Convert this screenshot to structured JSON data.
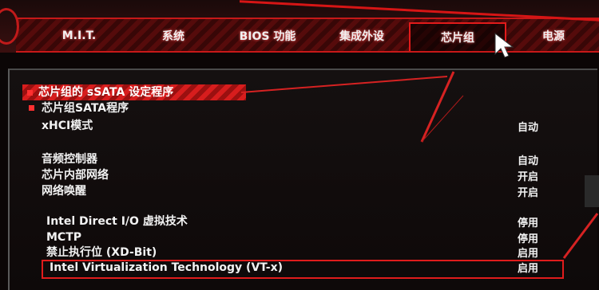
{
  "tabs": [
    {
      "label": "M.I.T."
    },
    {
      "label": "系统"
    },
    {
      "label": "BIOS 功能"
    },
    {
      "label": "集成外设"
    },
    {
      "label": "芯片组"
    },
    {
      "label": "电源"
    }
  ],
  "active_tab": "芯片组",
  "section_header": "芯片组的 sSATA 设定程序",
  "items": [
    {
      "label": "芯片组SATA程序",
      "value": ""
    },
    {
      "label": "xHCI模式",
      "value": "自动"
    },
    {
      "label": "音频控制器",
      "value": "自动"
    },
    {
      "label": "芯片内部网络",
      "value": "开启"
    },
    {
      "label": "网络唤醒",
      "value": "开启"
    },
    {
      "label": "Intel Direct I/O 虚拟技术",
      "value": "停用"
    },
    {
      "label": "MCTP",
      "value": "停用"
    },
    {
      "label": "禁止执行位 (XD-Bit)",
      "value": "启用"
    },
    {
      "label": "Intel Virtualization Technology (VT-x)",
      "value": "启用"
    }
  ],
  "colors": {
    "accent": "#e01c1c",
    "background": "#0b0606",
    "text": "#f2f2f2"
  }
}
